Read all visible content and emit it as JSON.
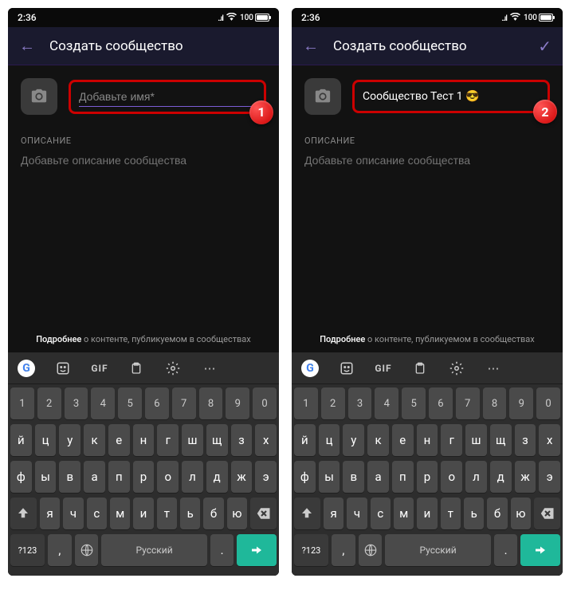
{
  "screens": [
    {
      "step": "1",
      "status": {
        "time": "2:36",
        "battery": "100"
      },
      "header": {
        "title": "Создать сообщество",
        "show_confirm": false
      },
      "name_field": {
        "placeholder": "Добавьте имя*",
        "value": ""
      },
      "description": {
        "label": "ОПИСАНИЕ",
        "placeholder": "Добавьте описание сообщества"
      },
      "footer": {
        "bold": "Подробнее",
        "rest": " о контенте, публикуемом в сообществах"
      }
    },
    {
      "step": "2",
      "status": {
        "time": "2:36",
        "battery": "100"
      },
      "header": {
        "title": "Создать сообщество",
        "show_confirm": true
      },
      "name_field": {
        "placeholder": "",
        "value": "Сообщество Тест 1 😎"
      },
      "description": {
        "label": "ОПИСАНИЕ",
        "placeholder": "Добавьте описание сообщества"
      },
      "footer": {
        "bold": "Подробнее",
        "rest": " о контенте, публикуемом в сообществах"
      }
    }
  ],
  "keyboard": {
    "suggest_icons": [
      "google",
      "sticker",
      "gif",
      "clipboard",
      "settings",
      "more"
    ],
    "gif_label": "GIF",
    "row_nums": [
      "1",
      "2",
      "3",
      "4",
      "5",
      "6",
      "7",
      "8",
      "9",
      "0"
    ],
    "row1": [
      "й",
      "ц",
      "у",
      "к",
      "е",
      "н",
      "г",
      "ш",
      "щ",
      "з",
      "х"
    ],
    "row2": [
      "ф",
      "ы",
      "в",
      "а",
      "п",
      "р",
      "о",
      "л",
      "д",
      "ж",
      "э"
    ],
    "row3": [
      "я",
      "ч",
      "с",
      "м",
      "и",
      "т",
      "ь",
      "б",
      "ю"
    ],
    "bottom": {
      "symbols": "?123",
      "comma": ",",
      "space": "Русский",
      "period": "."
    }
  }
}
